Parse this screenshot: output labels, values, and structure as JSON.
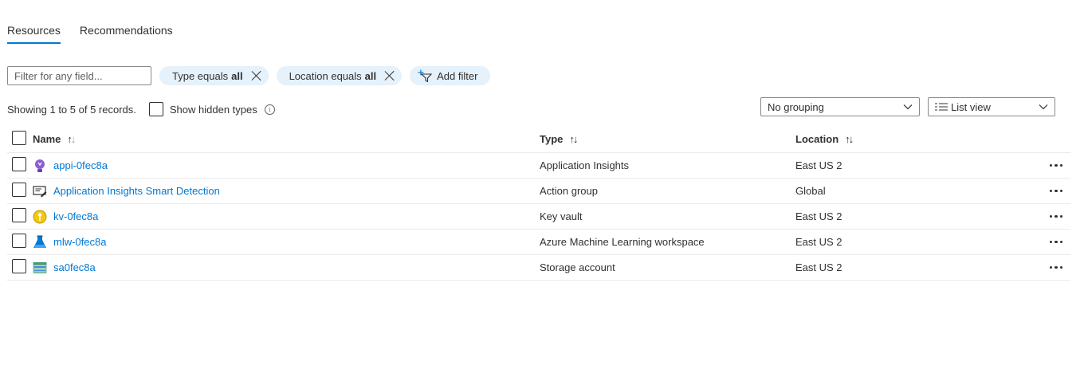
{
  "tabs": [
    {
      "label": "Resources",
      "active": true
    },
    {
      "label": "Recommendations",
      "active": false
    }
  ],
  "filter": {
    "placeholder": "Filter for any field...",
    "pills": [
      {
        "prefix": "Type equals",
        "value": "all"
      },
      {
        "prefix": "Location equals",
        "value": "all"
      }
    ],
    "add_filter_label": "Add filter"
  },
  "records_text": "Showing 1 to 5 of 5 records.",
  "show_hidden_label": "Show hidden types",
  "grouping": {
    "selected": "No grouping"
  },
  "view": {
    "selected": "List view"
  },
  "table": {
    "headers": {
      "name": "Name",
      "type": "Type",
      "location": "Location"
    },
    "rows": [
      {
        "name": "appi-0fec8a",
        "icon": "application-insights-icon",
        "type": "Application Insights",
        "location": "East US 2"
      },
      {
        "name": "Application Insights Smart Detection",
        "icon": "action-group-icon",
        "type": "Action group",
        "location": "Global"
      },
      {
        "name": "kv-0fec8a",
        "icon": "key-vault-icon",
        "type": "Key vault",
        "location": "East US 2"
      },
      {
        "name": "mlw-0fec8a",
        "icon": "machine-learning-icon",
        "type": "Azure Machine Learning workspace",
        "location": "East US 2"
      },
      {
        "name": "sa0fec8a",
        "icon": "storage-account-icon",
        "type": "Storage account",
        "location": "East US 2"
      }
    ]
  },
  "colors": {
    "accent": "#0078d4",
    "pill_bg": "#e5f1fb",
    "border": "#edebe9"
  }
}
